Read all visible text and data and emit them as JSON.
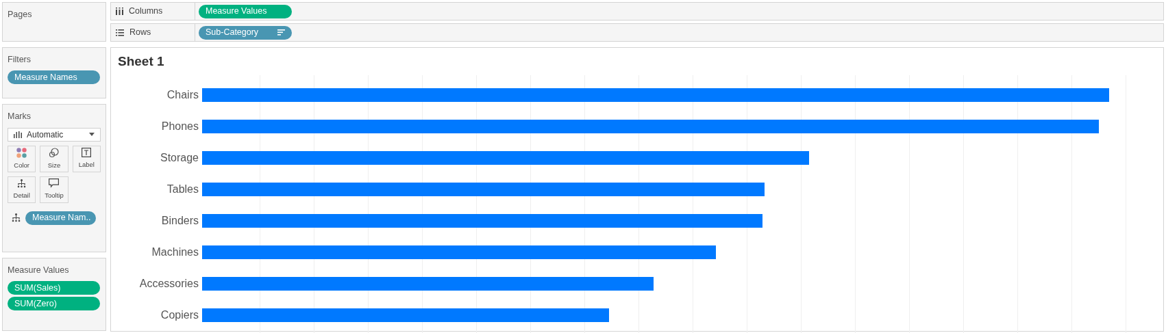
{
  "pages": {
    "title": "Pages"
  },
  "shelves": [
    {
      "kind": "columns",
      "label": "Columns",
      "pill": {
        "text": "Measure Values",
        "color": "#00b180",
        "sorted": false
      }
    },
    {
      "kind": "rows",
      "label": "Rows",
      "pill": {
        "text": "Sub-Category",
        "color": "#4996b2",
        "sorted": true
      }
    }
  ],
  "filters": {
    "title": "Filters",
    "pills": [
      {
        "text": "Measure Names",
        "color": "#4996b2"
      }
    ]
  },
  "marks": {
    "title": "Marks",
    "mark_type": "Automatic",
    "cards": [
      {
        "kind": "color",
        "label": "Color"
      },
      {
        "kind": "size",
        "label": "Size"
      },
      {
        "kind": "label",
        "label": "Label"
      },
      {
        "kind": "detail",
        "label": "Detail"
      },
      {
        "kind": "tooltip",
        "label": "Tooltip"
      }
    ],
    "fields": [
      {
        "kind": "detail",
        "text": "Measure Nam..",
        "color": "#4996b2"
      }
    ]
  },
  "measure_values": {
    "title": "Measure Values",
    "pills": [
      {
        "text": "SUM(Sales)",
        "color": "#00b180"
      },
      {
        "text": "SUM(Zero)",
        "color": "#00b180"
      }
    ]
  },
  "sheet": {
    "title": "Sheet 1",
    "rows": [
      {
        "label": "Chairs"
      },
      {
        "label": "Phones"
      },
      {
        "label": "Storage"
      },
      {
        "label": "Tables"
      },
      {
        "label": "Binders"
      },
      {
        "label": "Machines"
      },
      {
        "label": "Accessories"
      },
      {
        "label": "Copiers"
      }
    ]
  }
}
